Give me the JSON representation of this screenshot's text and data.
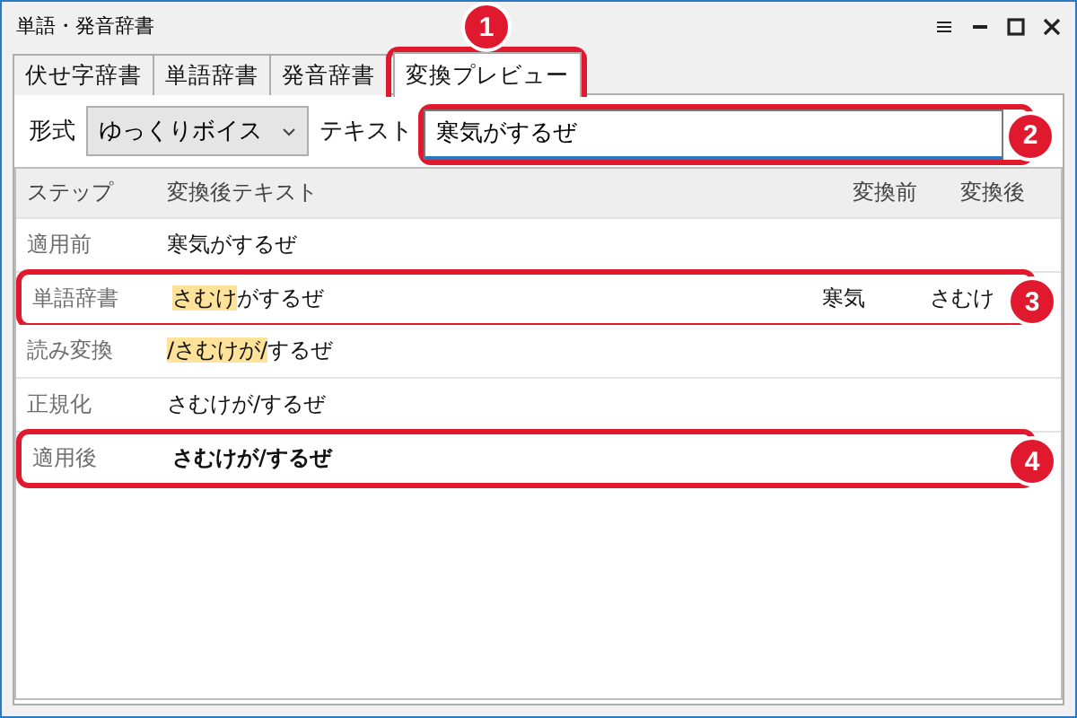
{
  "window": {
    "title": "単語・発音辞書"
  },
  "tabs": [
    {
      "label": "伏せ字辞書",
      "selected": false
    },
    {
      "label": "単語辞書",
      "selected": false
    },
    {
      "label": "発音辞書",
      "selected": false
    },
    {
      "label": "変換プレビュー",
      "selected": true,
      "callout": "1"
    }
  ],
  "form": {
    "format_label": "形式",
    "format_value": "ゆっくりボイス",
    "text_label": "テキスト",
    "text_value": "寒気がするぜ",
    "text_callout": "2"
  },
  "table": {
    "columns": [
      "ステップ",
      "変換後テキスト",
      "変換前",
      "変換後"
    ],
    "rows": [
      {
        "step": "適用前",
        "segments": [
          {
            "text": "寒気がするぜ",
            "highlight": false
          }
        ],
        "before": "",
        "after": "",
        "bold": false
      },
      {
        "step": "単語辞書",
        "segments": [
          {
            "text": "さむけ",
            "highlight": true
          },
          {
            "text": "がするぜ",
            "highlight": false
          }
        ],
        "before": "寒気",
        "after": "さむけ",
        "bold": false,
        "callout": "3"
      },
      {
        "step": "読み変換",
        "segments": [
          {
            "text": "/さむけが/",
            "highlight": true
          },
          {
            "text": "するぜ",
            "highlight": false
          }
        ],
        "before": "",
        "after": "",
        "bold": false
      },
      {
        "step": "正規化",
        "segments": [
          {
            "text": "さむけが/するぜ",
            "highlight": false
          }
        ],
        "before": "",
        "after": "",
        "bold": false
      },
      {
        "step": "適用後",
        "segments": [
          {
            "text": "さむけが/するぜ",
            "highlight": false
          }
        ],
        "before": "",
        "after": "",
        "bold": true,
        "callout": "4"
      }
    ]
  }
}
